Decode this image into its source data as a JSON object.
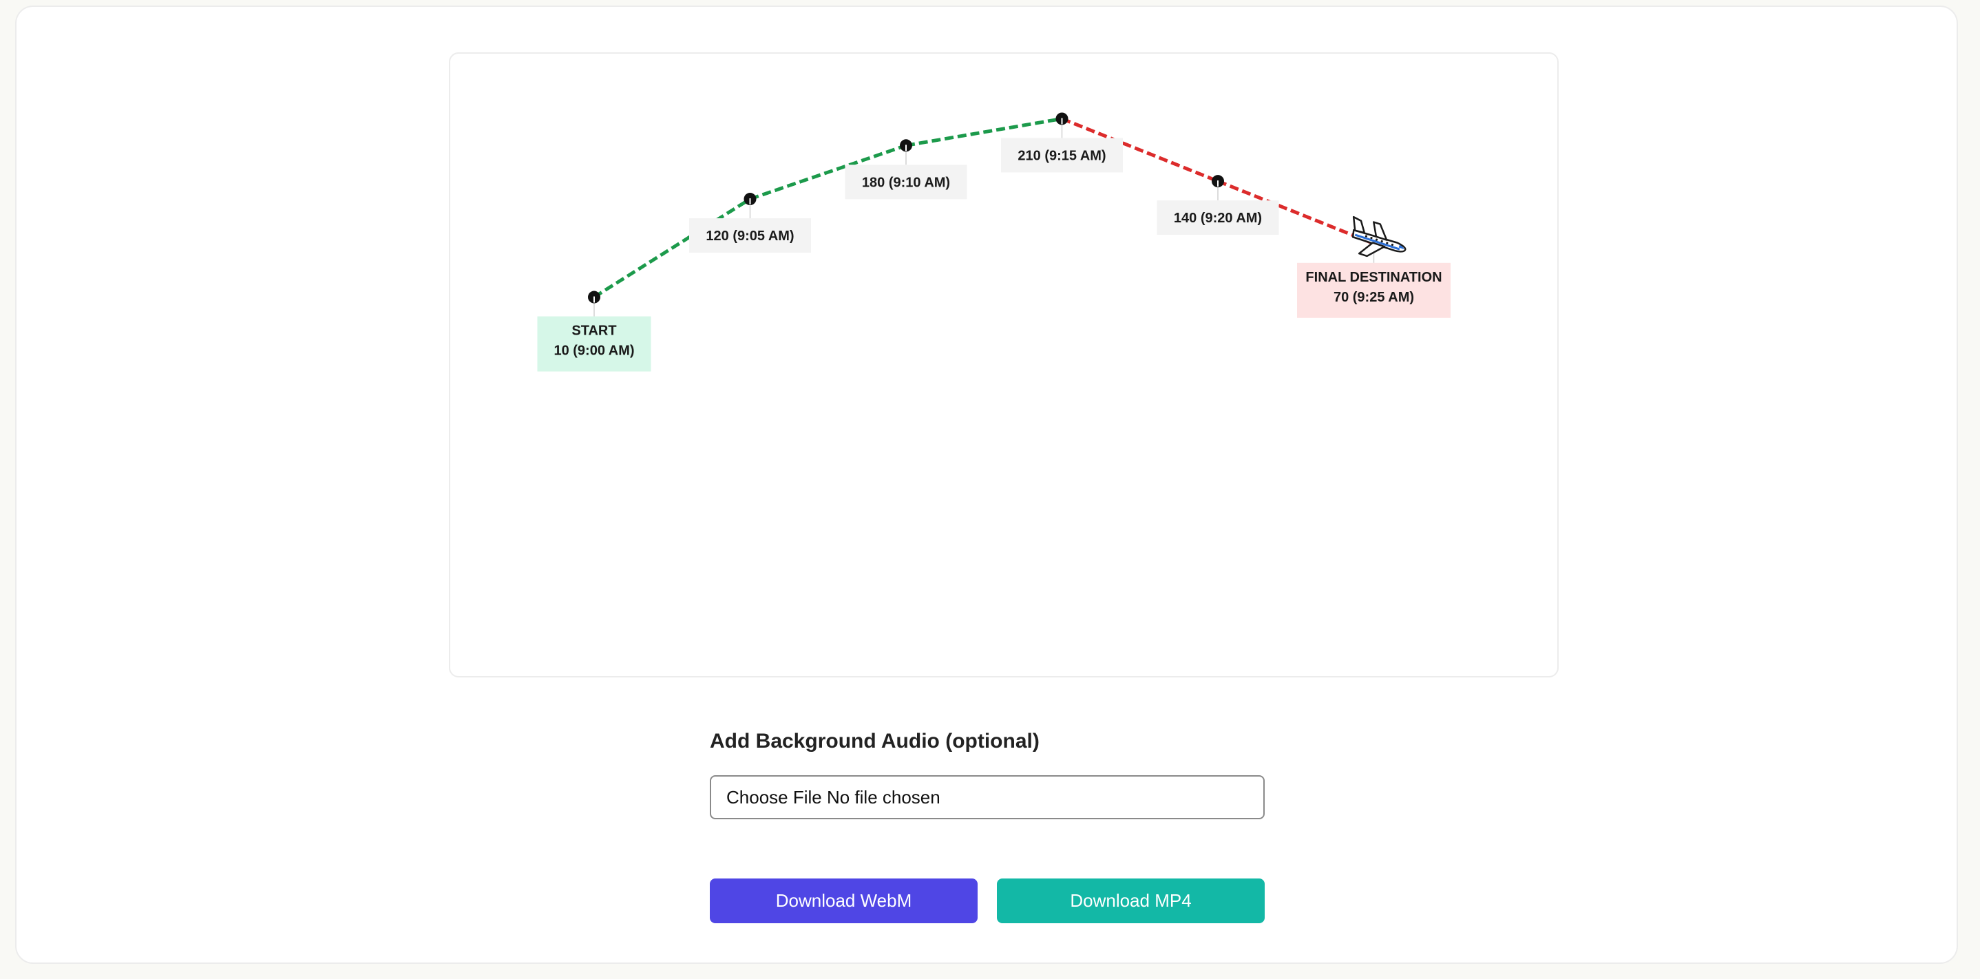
{
  "chart_data": {
    "type": "line",
    "series": [
      {
        "points": [
          {
            "time": "9:00 AM",
            "value": 10
          },
          {
            "time": "9:05 AM",
            "value": 120
          },
          {
            "time": "9:10 AM",
            "value": 180
          },
          {
            "time": "9:15 AM",
            "value": 210
          },
          {
            "time": "9:20 AM",
            "value": 140
          },
          {
            "time": "9:25 AM",
            "value": 70
          }
        ]
      }
    ],
    "labels": [
      {
        "lines": [
          "START",
          "10 (9:00 AM)"
        ],
        "style": "start"
      },
      {
        "lines": [
          "120 (9:05 AM)"
        ],
        "style": "normal"
      },
      {
        "lines": [
          "180 (9:10 AM)"
        ],
        "style": "normal"
      },
      {
        "lines": [
          "210 (9:15 AM)"
        ],
        "style": "normal"
      },
      {
        "lines": [
          "140 (9:20 AM)"
        ],
        "style": "normal"
      },
      {
        "lines": [
          "FINAL DESTINATION",
          "70 (9:25 AM)"
        ],
        "style": "end"
      }
    ],
    "colors": {
      "rising": "#1c9a4b",
      "falling": "#dc2b2b",
      "point": "#111111",
      "start_box": "#d6f7e8",
      "end_box": "#fde2e2",
      "label_box": "#f3f3f3"
    },
    "end_marker_icon": "airplane-icon"
  },
  "audio": {
    "title": "Add Background Audio (optional)",
    "file_button": "Choose File",
    "file_status": "No file chosen"
  },
  "buttons": {
    "webm": "Download WebM",
    "mp4": "Download MP4"
  },
  "colors": {
    "webm_button": "#4f46e5",
    "mp4_button": "#13b8a6"
  }
}
